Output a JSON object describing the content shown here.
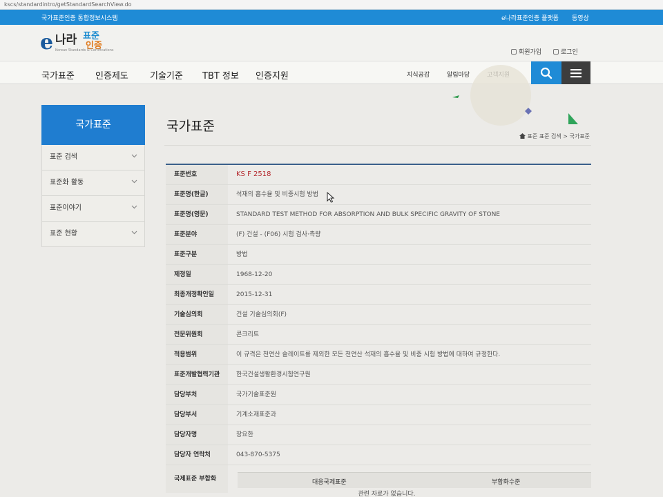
{
  "browser": {
    "url": "kscs/standardintro/getStandardSearchView.do"
  },
  "topbar": {
    "system_name": "국가표준인증 통합정보시스템",
    "link1": "e나라표준인증 플랫폼",
    "link2": "동영상"
  },
  "header": {
    "logo": {
      "e": "e",
      "nara": "나라",
      "pyo": "표준",
      "in": "인증",
      "small": "Korean Standards & Certifications"
    },
    "join": "회원가입",
    "login": "로그인"
  },
  "nav": {
    "main": [
      "국가표준",
      "인증제도",
      "기술기준",
      "TBT 정보",
      "인증지원"
    ],
    "sub": [
      "지식공감",
      "알림마당",
      "고객지원"
    ]
  },
  "sidebar": {
    "title": "국가표준",
    "items": [
      {
        "label": "표준 검색"
      },
      {
        "label": "표준화 활동"
      },
      {
        "label": "표준이야기"
      },
      {
        "label": "표준 현황"
      }
    ]
  },
  "page": {
    "title": "국가표준",
    "breadcrumb": "표준 표준 검색 > 국가표준"
  },
  "detail": {
    "rows": [
      {
        "label": "표준번호",
        "value": "KS F 2518"
      },
      {
        "label": "표준명(한글)",
        "value": "석재의 흡수율 및 비중시험 방법"
      },
      {
        "label": "표준명(영문)",
        "value": "STANDARD TEST METHOD FOR ABSORPTION AND BULK SPECIFIC GRAVITY OF STONE"
      },
      {
        "label": "표준분야",
        "value": "(F) 건설 - (F06) 시험 검사·측량"
      },
      {
        "label": "표준구분",
        "value": "방법"
      },
      {
        "label": "제정일",
        "value": "1968-12-20"
      },
      {
        "label": "최종개정확인일",
        "value": "2015-12-31"
      },
      {
        "label": "기술심의회",
        "value": "건설 기술심의회(F)"
      },
      {
        "label": "전문위원회",
        "value": "콘크리트"
      },
      {
        "label": "적용범위",
        "value": "이 규격은 천연산 슬레이트를 제외한 모든 천연산 석재의 흡수율 및 비중 시험 방법에 대하여 규정한다."
      },
      {
        "label": "표준개발협력기관",
        "value": "한국건설생활환경시험연구원"
      },
      {
        "label": "담당부처",
        "value": "국가기술표준원"
      },
      {
        "label": "담당부서",
        "value": "기계소재표준과"
      },
      {
        "label": "담당자명",
        "value": "장요한"
      },
      {
        "label": "담당자 연락처",
        "value": "043-870-5375"
      }
    ],
    "intl": {
      "label": "국제표준 부합화",
      "col1": "대응국제표준",
      "col2": "부합화수준",
      "empty": "관련 자료가 없습니다."
    }
  },
  "colors": {
    "accent": "#1f8bd6",
    "sidebar_title": "#1f7dd0",
    "code_red": "#b4282d",
    "menu_dark": "#3d3d3d"
  }
}
